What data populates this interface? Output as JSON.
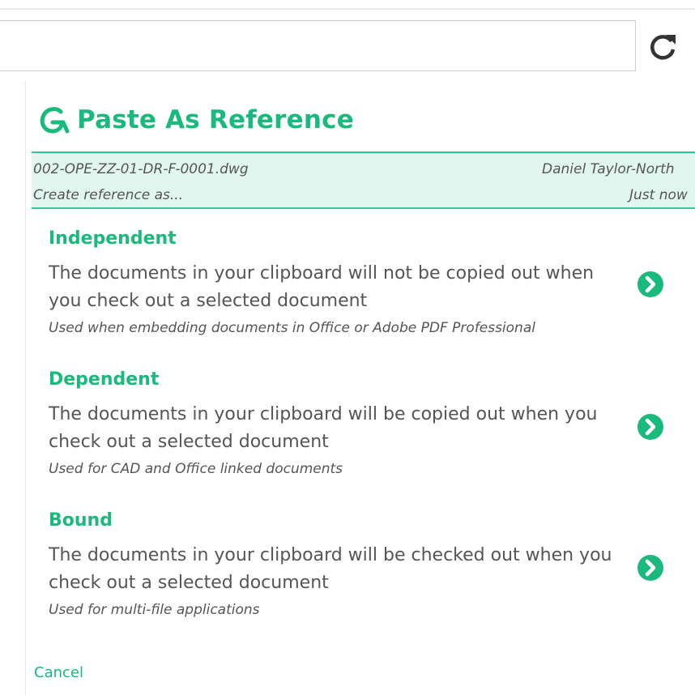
{
  "toolbar": {
    "search_value": "",
    "refresh_icon": "refresh-icon"
  },
  "dialog": {
    "title": "Paste As Reference",
    "logo_icon": "g-logo-icon",
    "info": {
      "filename": "002-OPE-ZZ-01-DR-F-0001.dwg",
      "user": "Daniel Taylor-North",
      "subtitle": "Create reference as...",
      "time": "Just now"
    },
    "options": [
      {
        "title": "Independent",
        "desc": "The documents in your clipboard will not be copied out when you check out a selected document",
        "note": "Used when embedding documents in Office or Adobe PDF Professional"
      },
      {
        "title": "Dependent",
        "desc": "The documents in your clipboard will be copied out when you check out a selected document",
        "note": "Used for CAD and Office linked documents"
      },
      {
        "title": "Bound",
        "desc": "The documents in your clipboard will be checked out when you check out a selected document",
        "note": "Used for multi-file applications"
      }
    ],
    "cancel_label": "Cancel"
  },
  "colors": {
    "accent": "#1ab97c",
    "info_bg": "#e2f6f0",
    "text": "#555555"
  }
}
